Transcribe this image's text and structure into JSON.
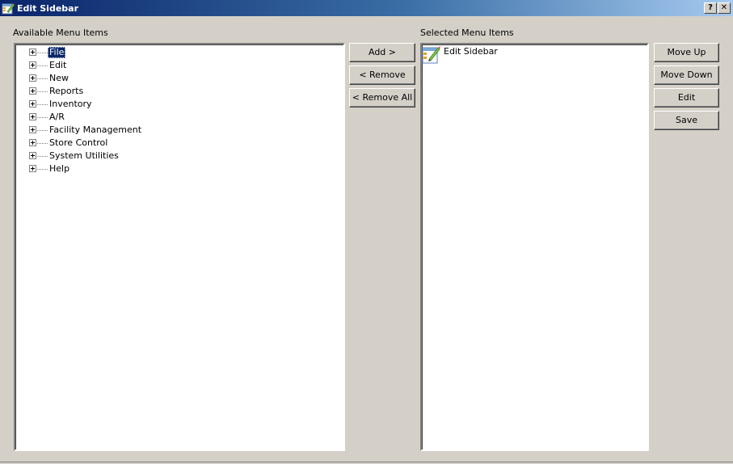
{
  "window": {
    "title": "Edit Sidebar",
    "help_button": "?",
    "close_button": "✕"
  },
  "available": {
    "label": "Available Menu Items",
    "items": [
      {
        "label": "File",
        "selected": true
      },
      {
        "label": "Edit",
        "selected": false
      },
      {
        "label": "New",
        "selected": false
      },
      {
        "label": "Reports",
        "selected": false
      },
      {
        "label": "Inventory",
        "selected": false
      },
      {
        "label": "A/R",
        "selected": false
      },
      {
        "label": "Facility Management",
        "selected": false
      },
      {
        "label": "Store Control",
        "selected": false
      },
      {
        "label": "System Utilities",
        "selected": false
      },
      {
        "label": "Help",
        "selected": false
      }
    ]
  },
  "middle_buttons": {
    "add": "Add >",
    "remove": "< Remove",
    "remove_all": "< Remove All"
  },
  "selected": {
    "label": "Selected Menu Items",
    "items": [
      {
        "label": "Edit Sidebar",
        "icon": "edit-sidebar-icon"
      }
    ]
  },
  "right_buttons": {
    "move_up": "Move Up",
    "move_down": "Move Down",
    "edit": "Edit",
    "save": "Save"
  }
}
